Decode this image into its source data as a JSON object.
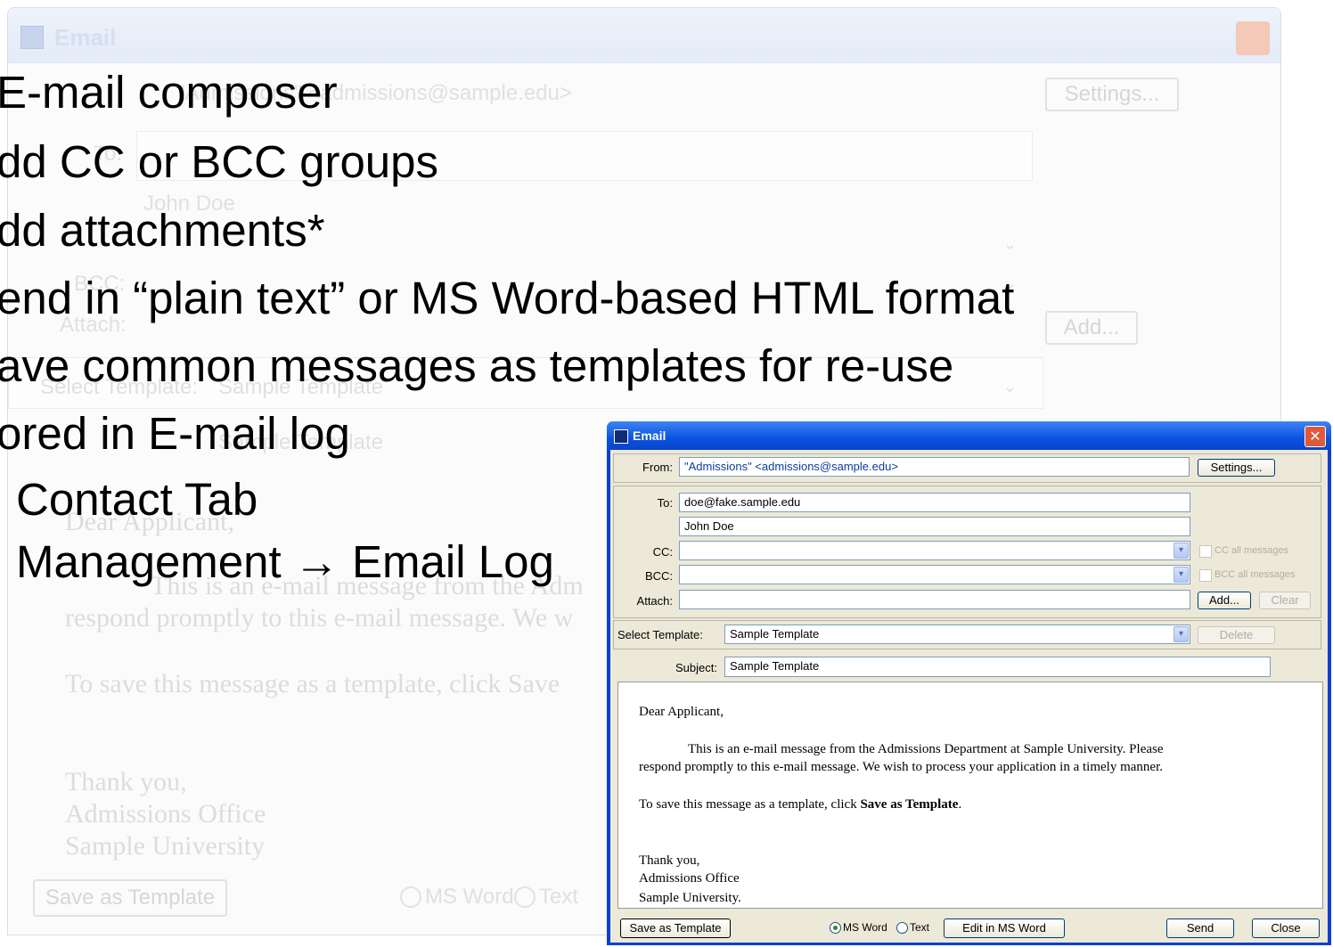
{
  "background_window": {
    "title": "Email",
    "from_value": "\"Admissions\" <admissions@sample.edu>",
    "settings_label": "Settings...",
    "to_label": "To:",
    "to_name": "John Doe",
    "bcc_label": "BCC:",
    "attach_label": "Attach:",
    "add_label": "Add...",
    "select_template_label": "Select Template:",
    "template_value": "Sample Template",
    "subject_value": "Sample Template",
    "greeting": "Dear Applicant,",
    "body_line1": "This is an e-mail message from the Adm",
    "body_line2": "respond promptly to this e-mail message. We w",
    "body_line3": "To save this message as a template, click Save",
    "thanks": "Thank you,",
    "office": "Admissions Office",
    "university": "Sample University",
    "save_template_label": "Save as Template",
    "ms_word_label": "MS Word",
    "text_label": "Text"
  },
  "slide": {
    "lines": [
      "E-mail composer",
      "dd CC or BCC groups",
      "dd attachments*",
      "end in “plain text” or MS Word-based HTML format",
      "ave common messages as templates for re-use",
      "ored in E-mail log",
      "Contact Tab",
      "Management → Email Log"
    ]
  },
  "dialog": {
    "title": "Email",
    "close_glyph": "✕",
    "from_label": "From:",
    "from_value": "\"Admissions\" <admissions@sample.edu>",
    "settings_label": "Settings...",
    "to_label": "To:",
    "to_value": "doe@fake.sample.edu",
    "to_name": "John Doe",
    "cc_label": "CC:",
    "bcc_label": "BCC:",
    "cc_all_label": "CC all messages",
    "bcc_all_label": "BCC all messages",
    "attach_label": "Attach:",
    "add_label": "Add...",
    "clear_label": "Clear",
    "select_template_label": "Select Template:",
    "template_value": "Sample Template",
    "delete_label": "Delete",
    "subject_label": "Subject:",
    "subject_value": "Sample Template",
    "body": {
      "greeting": "Dear Applicant,",
      "para1_line1": "This is an e-mail message from the Admissions Department at Sample University. Please",
      "para1_line2": "respond promptly to this e-mail message. We wish to process your application in a timely manner.",
      "para2_prefix": "To save this message as a template, click ",
      "para2_bold": "Save as Template",
      "para2_suffix": ".",
      "thanks": "Thank you,",
      "office": "Admissions Office",
      "university": "Sample University."
    },
    "save_template_label": "Save as Template",
    "format_selected": "MS Word",
    "ms_word_label": "MS Word",
    "text_label": "Text",
    "edit_word_label": "Edit in MS Word",
    "send_label": "Send",
    "close_label": "Close",
    "dropdown_glyph": "▾"
  }
}
